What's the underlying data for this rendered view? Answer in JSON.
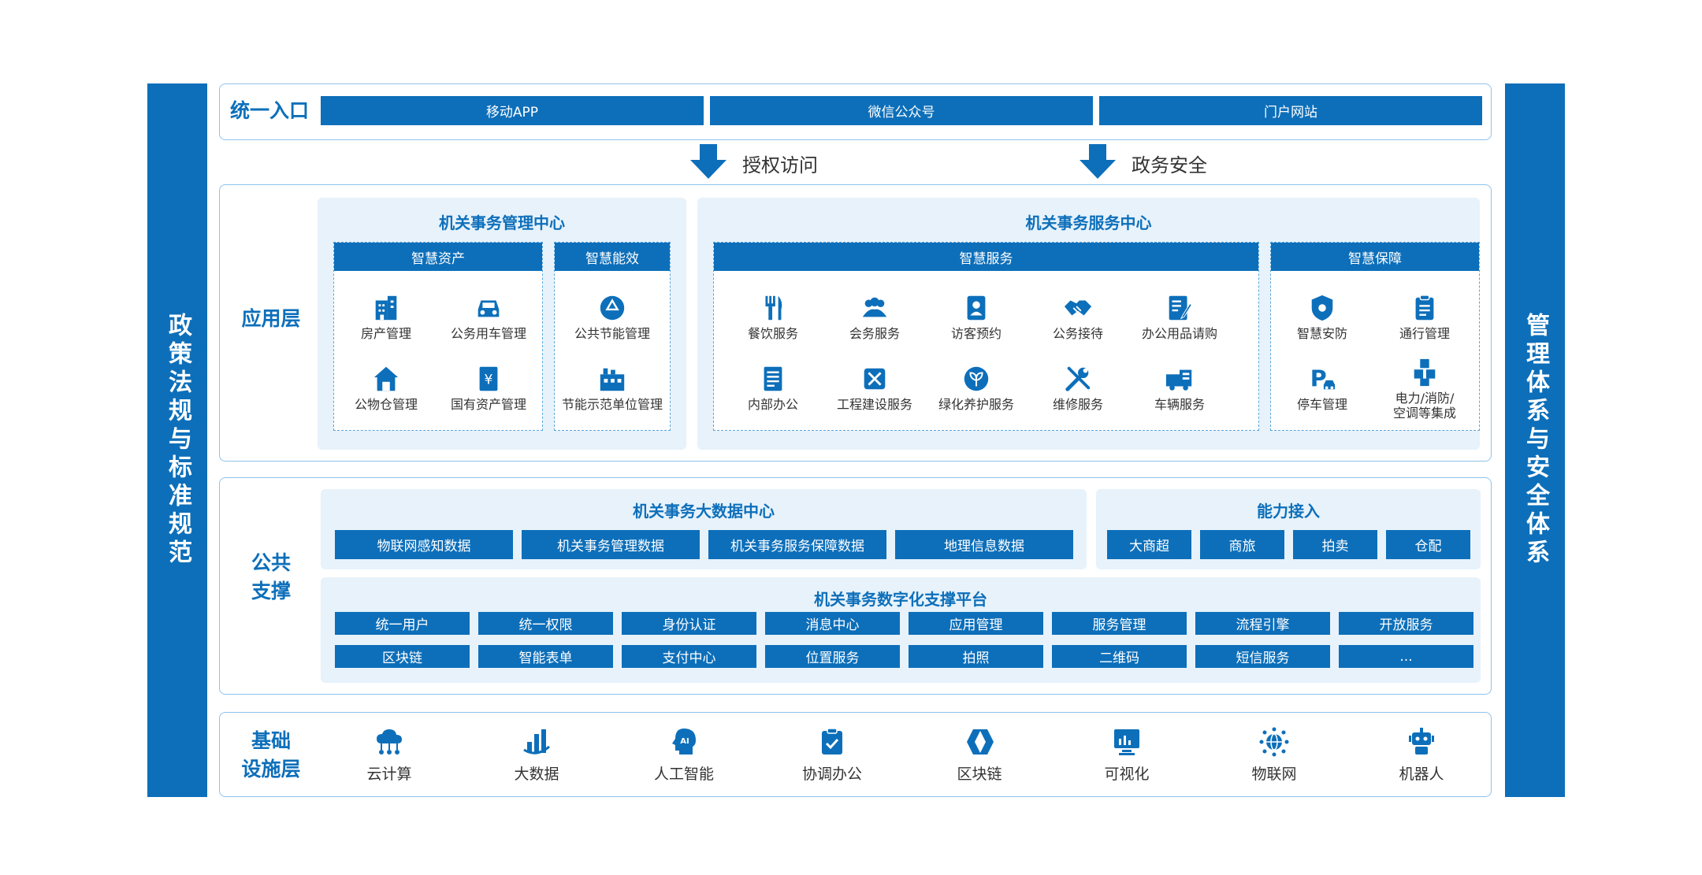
{
  "left_bar": "政策法规与标准规范",
  "right_bar": "管理体系与安全体系",
  "entry": {
    "label": "统一入口",
    "buttons": [
      "移动APP",
      "微信公众号",
      "门户网站"
    ]
  },
  "arrows": [
    "授权访问",
    "政务安全"
  ],
  "app_layer": {
    "label": "应用层",
    "mgmt_center": {
      "title": "机关事务管理中心",
      "smart_assets": {
        "title": "智慧资产",
        "items": [
          "房产管理",
          "公务用车管理",
          "公物仓管理",
          "国有资产管理"
        ]
      },
      "smart_energy": {
        "title": "智慧能效",
        "items": [
          "公共节能管理",
          "节能示范单位管理"
        ]
      }
    },
    "service_center": {
      "title": "机关事务服务中心",
      "smart_service": {
        "title": "智慧服务",
        "items": [
          "餐饮服务",
          "会务服务",
          "访客预约",
          "公务接待",
          "办公用品请购",
          "内部办公",
          "工程建设服务",
          "绿化养护服务",
          "维修服务",
          "车辆服务"
        ]
      },
      "smart_support": {
        "title": "智慧保障",
        "items": [
          "智慧安防",
          "通行管理",
          "停车管理",
          "电力/消防/",
          "空调等集成"
        ]
      }
    }
  },
  "public_support": {
    "label_1": "公共",
    "label_2": "支撑",
    "bigdata": {
      "title": "机关事务大数据中心",
      "items": [
        "物联网感知数据",
        "机关事务管理数据",
        "机关事务服务保障数据",
        "地理信息数据"
      ]
    },
    "ability": {
      "title": "能力接入",
      "items": [
        "大商超",
        "商旅",
        "拍卖",
        "仓配"
      ]
    },
    "platform": {
      "title": "机关事务数字化支撑平台",
      "row1": [
        "统一用户",
        "统一权限",
        "身份认证",
        "消息中心",
        "应用管理",
        "服务管理",
        "流程引擎",
        "开放服务"
      ],
      "row2": [
        "区块链",
        "智能表单",
        "支付中心",
        "位置服务",
        "拍照",
        "二维码",
        "短信服务",
        "..."
      ]
    }
  },
  "infra": {
    "label_1": "基础",
    "label_2": "设施层",
    "items": [
      "云计算",
      "大数据",
      "人工智能",
      "协调办公",
      "区块链",
      "可视化",
      "物联网",
      "机器人"
    ]
  },
  "colors": {
    "primary": "#0d6fba",
    "light_bg": "#e7f2fb",
    "border": "#8ec3ea"
  }
}
